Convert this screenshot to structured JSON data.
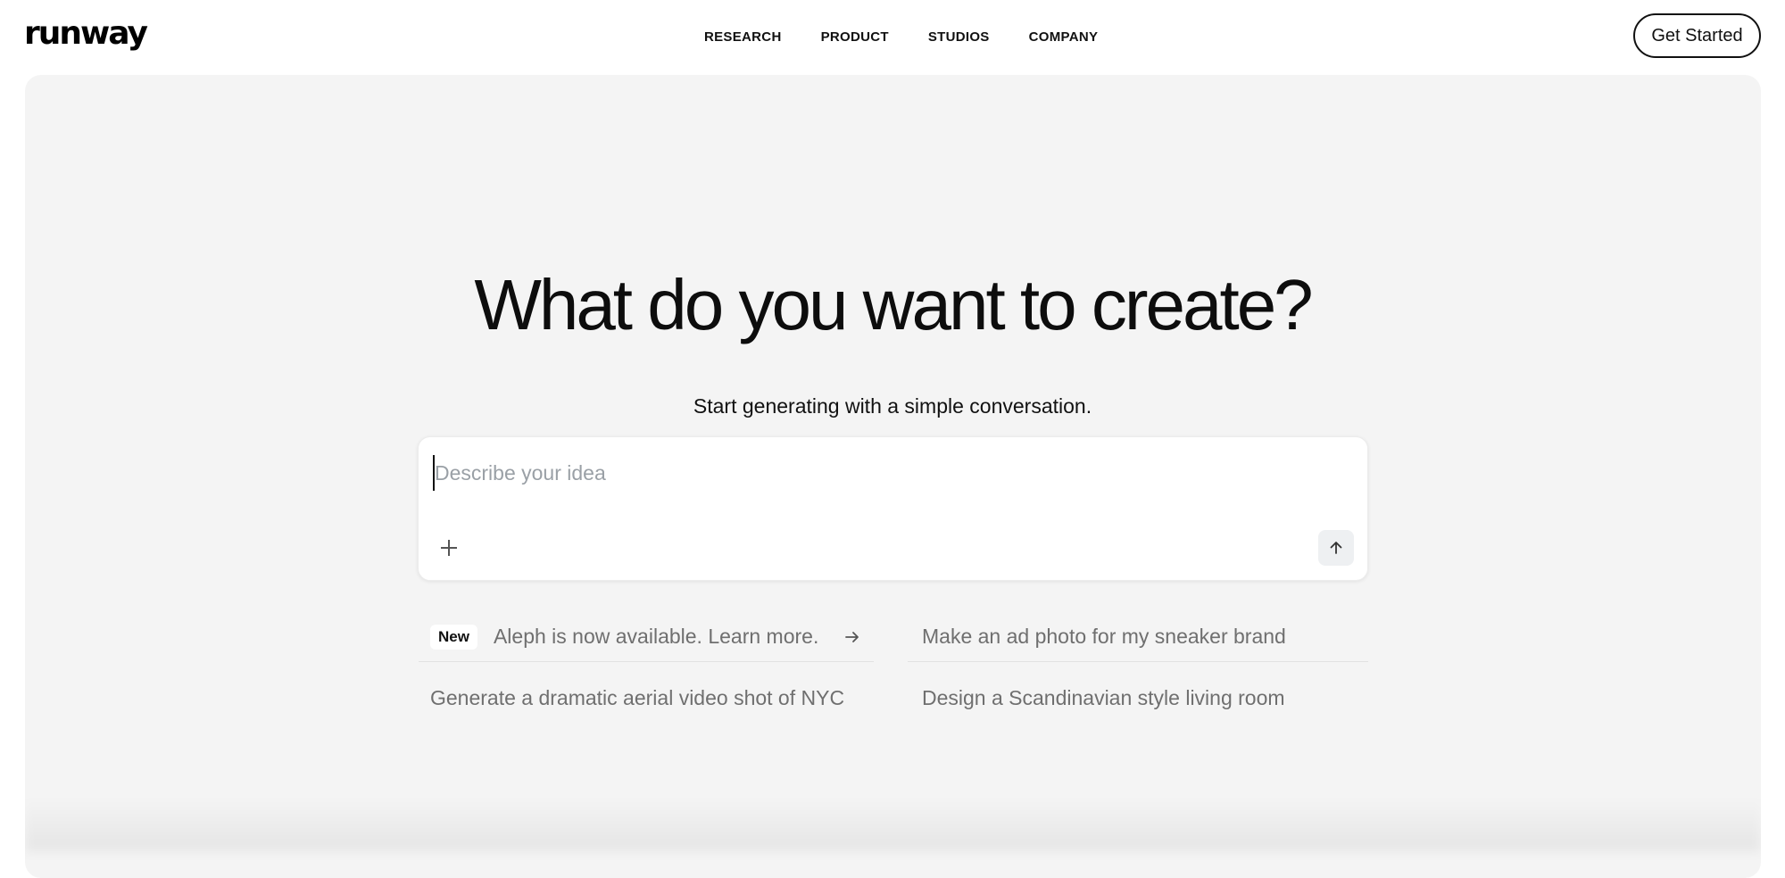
{
  "header": {
    "logo": "runway",
    "nav": [
      "RESEARCH",
      "PRODUCT",
      "STUDIOS",
      "COMPANY"
    ],
    "cta_label": "Get Started"
  },
  "hero": {
    "title": "What do you want to create?",
    "subtitle": "Start generating with a simple conversation."
  },
  "prompt": {
    "placeholder": "Describe your idea",
    "value": ""
  },
  "suggestions": {
    "badge": "New",
    "items": [
      "Aleph is now available. Learn more.",
      "Make an ad photo for my sneaker brand",
      "Generate a dramatic aerial video shot of NYC",
      "Design a Scandinavian style living room"
    ]
  },
  "icons": {
    "attach": "plus-icon",
    "send": "arrow-up-icon",
    "announcement": "arrow-right-icon"
  },
  "colors": {
    "panel_bg": "#f4f4f4",
    "text": "#111111",
    "muted": "#6f6f6f",
    "placeholder": "#9aa0a6"
  }
}
